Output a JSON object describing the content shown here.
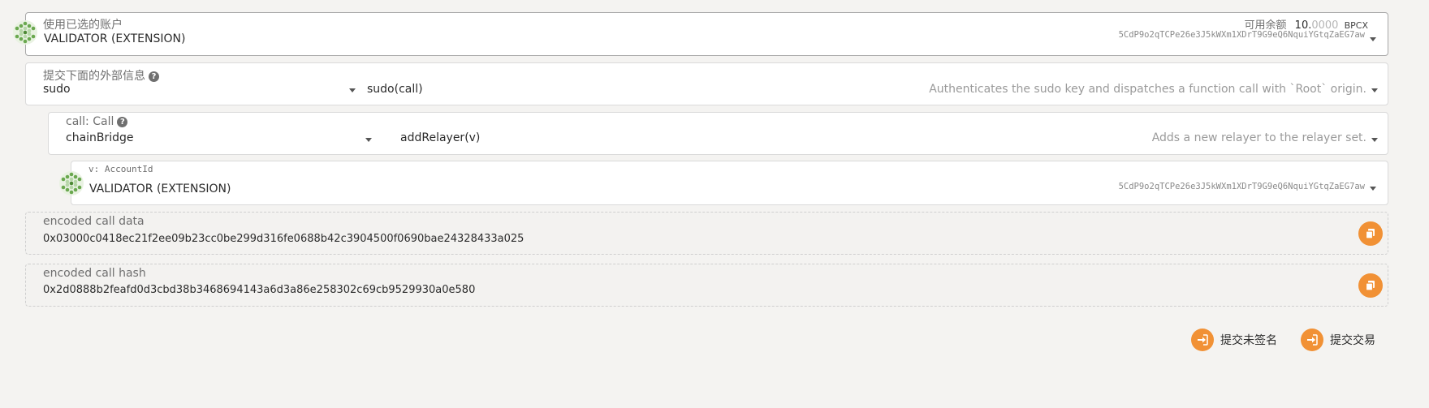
{
  "account": {
    "label": "使用已选的账户",
    "name": "VALIDATOR (EXTENSION)",
    "balance_label": "可用余额",
    "balance_whole": "10.",
    "balance_fraction": "0000",
    "balance_unit": "BPCX",
    "address": "5CdP9o2qTCPe26e3J5kWXm1XDrT9G9eQ6NquiYGtqZaEG7aw"
  },
  "extrinsic": {
    "label": "提交下面的外部信息",
    "section": "sudo",
    "method": "sudo(call)",
    "description": "Authenticates the sudo key and dispatches a function call with `Root` origin."
  },
  "call": {
    "label": "call: Call",
    "section": "chainBridge",
    "method": "addRelayer(v)",
    "description": "Adds a new relayer to the relayer set."
  },
  "param_v": {
    "label": "v: AccountId",
    "name": "VALIDATOR (EXTENSION)",
    "address": "5CdP9o2qTCPe26e3J5kWXm1XDrT9G9eQ6NquiYGtqZaEG7aw"
  },
  "encoded_call_data": {
    "label": "encoded call data",
    "value": "0x03000c0418ec21f2ee09b23cc0be299d316fe0688b42c3904500f0690bae24328433a025"
  },
  "encoded_call_hash": {
    "label": "encoded call hash",
    "value": "0x2d0888b2feafd0d3cbd38b3468694143a6d3a86e258302c69cb9529930a0e580"
  },
  "actions": {
    "submit_unsigned": "提交未签名",
    "submit_transaction": "提交交易"
  },
  "icons": {
    "identicon": "identicon-icon",
    "copy": "copy-icon",
    "sign_in": "sign-in-icon",
    "help": "help-icon",
    "caret": "chevron-down-icon"
  },
  "colors": {
    "accent": "#f19135",
    "identicon_dark": "#6aa84f",
    "identicon_light": "#b6d7a8"
  }
}
